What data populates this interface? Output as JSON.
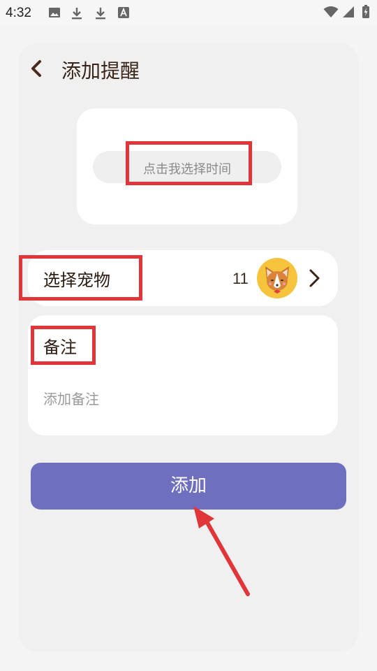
{
  "status_bar": {
    "time": "4:32",
    "left_icons": [
      "image-icon",
      "download-icon",
      "download-icon",
      "font-a-icon"
    ],
    "right_icons": [
      "wifi-icon",
      "cellular-signal-icon",
      "battery-charging-icon"
    ]
  },
  "header": {
    "back_icon": "chevron-left-icon",
    "title": "添加提醒"
  },
  "time_picker": {
    "placeholder": "点击我选择时间"
  },
  "pet_selector": {
    "label": "选择宠物",
    "count": "11",
    "avatar_icon": "corgi-avatar-icon",
    "chevron_icon": "chevron-right-icon"
  },
  "note": {
    "label": "备注",
    "placeholder": "添加备注"
  },
  "submit": {
    "label": "添加"
  },
  "colors": {
    "page_background": "#f4f4f4",
    "card_background": "#f0f0f0",
    "primary_button": "#6e70bf",
    "title_text": "#3a2418",
    "annotation_red": "#e0363a",
    "avatar_background": "#f6c43c"
  }
}
